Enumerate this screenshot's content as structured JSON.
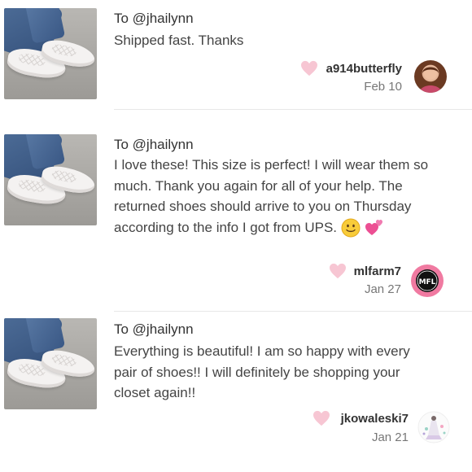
{
  "reviews": [
    {
      "to": "To @jhailynn",
      "text": "Shipped fast. Thanks",
      "author": "a914butterfly",
      "date": "Feb 10",
      "avatar": "profile-photo"
    },
    {
      "to": "To @jhailynn",
      "text": "I love these! This size is perfect! I will wear them so much. Thank you again for all of your help. The returned shoes should arrive to you on Thursday according to the info I got from UPS.",
      "emoji": [
        "slightly-smiling-face-emoji",
        "two-hearts-emoji"
      ],
      "author": "mlfarm7",
      "date": "Jan 27",
      "avatar": "monogram-logo",
      "monogram": "MFL"
    },
    {
      "to": "To @jhailynn",
      "text": "Everything is beautiful! I am so happy with every pair of shoes!! I will definitely be shopping your closet again!!",
      "author": "jkowaleski7",
      "date": "Jan 21",
      "avatar": "fashion-illustration"
    }
  ],
  "colors": {
    "heart": "#f7c6d3",
    "monogram_ring": "#f07aa1",
    "text": "#444444",
    "date": "#777777"
  }
}
